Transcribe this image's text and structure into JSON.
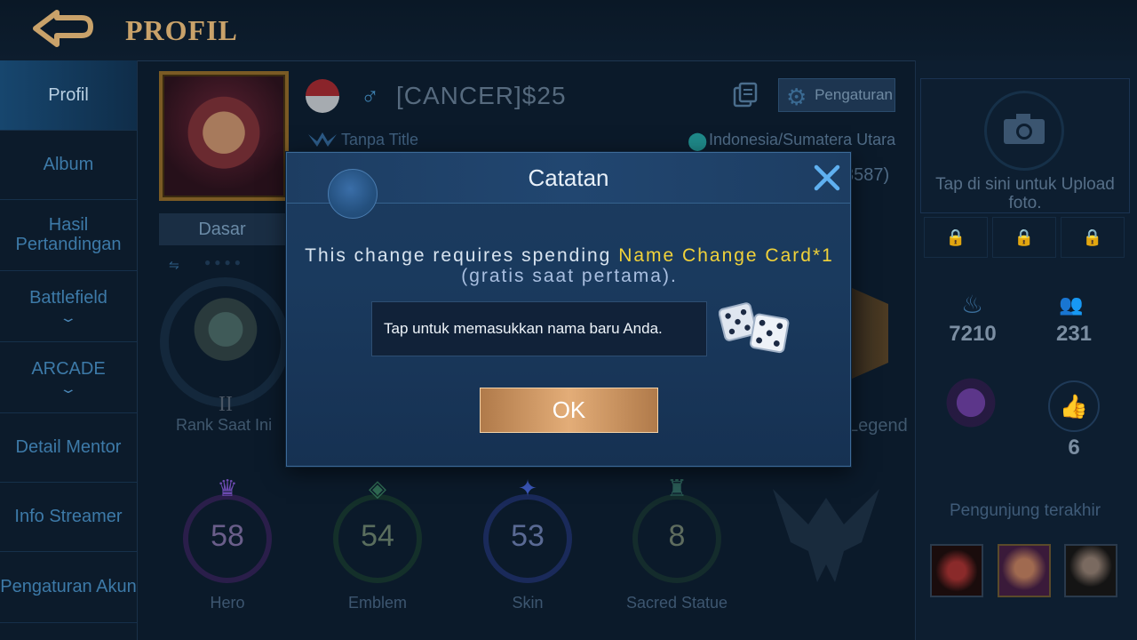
{
  "header": {
    "title": "PROFIL"
  },
  "sidebar": {
    "items": [
      {
        "label": "Profil",
        "active": true
      },
      {
        "label": "Album"
      },
      {
        "label": "Hasil Pertandingan"
      },
      {
        "label": "Battlefield",
        "has_dropdown": true
      },
      {
        "label": "ARCADE",
        "has_dropdown": true
      },
      {
        "label": "Detail Mentor"
      },
      {
        "label": "Info Streamer"
      },
      {
        "label": "Pengaturan Akun"
      }
    ]
  },
  "profile": {
    "tab": "Dasar",
    "gender_symbol": "♂",
    "player_name": "[CANCER]$25",
    "settings_label": "Pengaturan",
    "title": "Tanpa Title",
    "location": "Indonesia/Sumatera Utara",
    "id_fragment": "3587)",
    "rank_level": "II",
    "rank_label": "Rank Saat Ini",
    "legend_label": "Legend"
  },
  "stats": [
    {
      "value": "58",
      "label": "Hero",
      "color": "#6a3fb0"
    },
    {
      "value": "54",
      "label": "Emblem",
      "color": "#2f6a52"
    },
    {
      "value": "53",
      "label": "Skin",
      "color": "#3a56b8"
    },
    {
      "value": "8",
      "label": "Sacred Statue",
      "color": "#2a5c56"
    }
  ],
  "right_panel": {
    "upload_text": "Tap di sini untuk Upload foto.",
    "popularity": "7210",
    "followers": "231",
    "likes": "6",
    "visitors_label": "Pengunjung terakhir"
  },
  "modal": {
    "title": "Catatan",
    "message_prefix": "This change requires spending ",
    "message_highlight": "Name Change Card*1",
    "message_suffix": " (gratis saat pertama).",
    "input_placeholder": "Tap untuk memasukkan nama baru Anda.",
    "ok_label": "OK"
  },
  "icons": {
    "back": "back-arrow-icon",
    "close": "close-icon",
    "dice": "dice-icon",
    "gear": "gear-icon",
    "camera": "camera-icon"
  },
  "colors": {
    "accent_gold": "#c9a26a",
    "highlight_yellow": "#f1d23a",
    "ok_button": "#e3ad78",
    "modal_bg": "#1a3a5e"
  }
}
